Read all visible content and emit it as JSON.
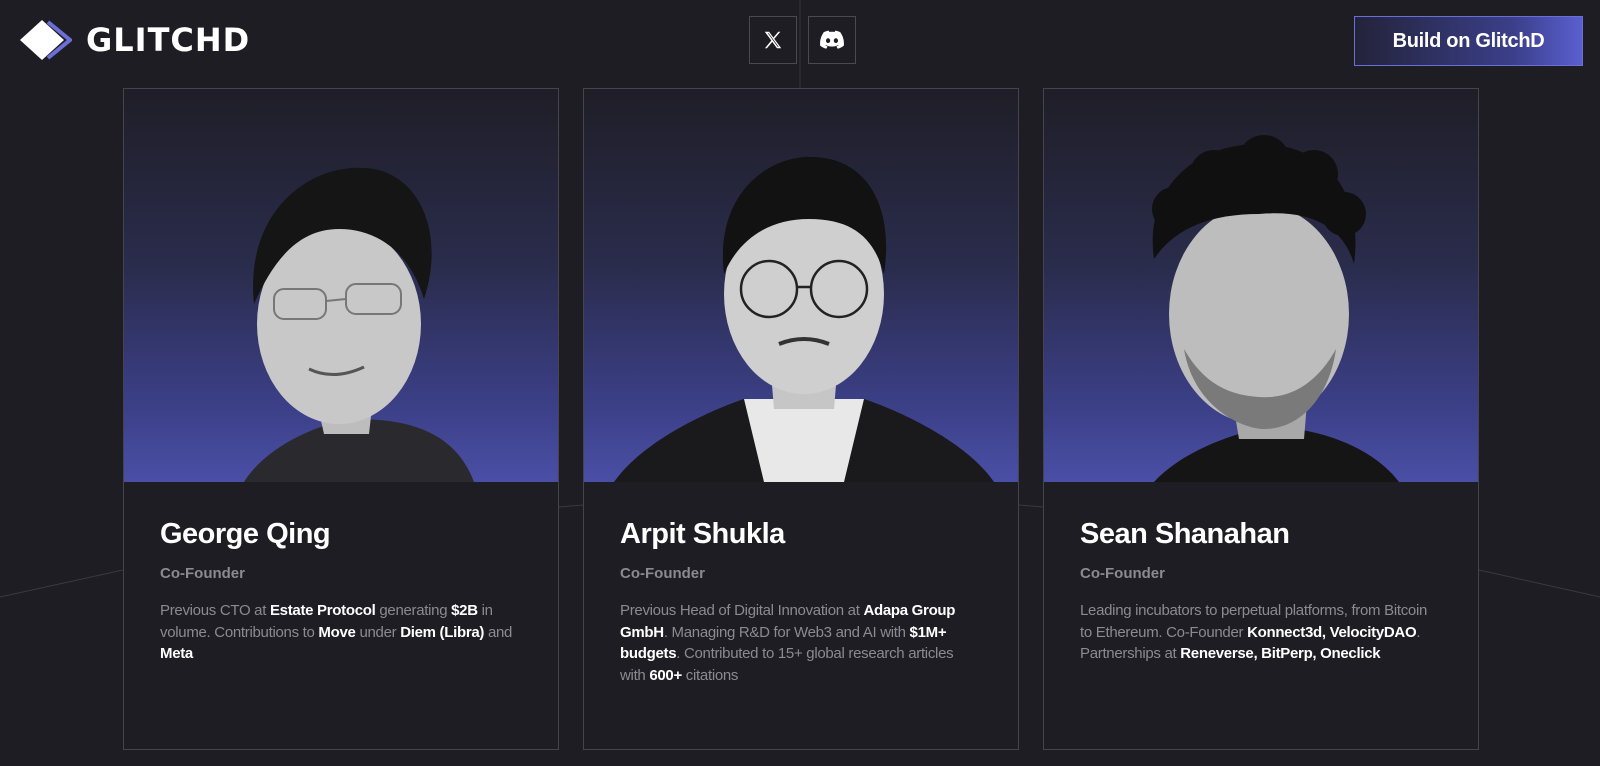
{
  "brand": {
    "name": "GLITCHD"
  },
  "header": {
    "social": [
      {
        "icon": "x-icon",
        "label": "X"
      },
      {
        "icon": "discord-icon",
        "label": "Discord"
      }
    ],
    "cta_label": "Build on GlitchD"
  },
  "colors": {
    "background": "#1e1d23",
    "accent": "#5a5fd0",
    "muted_text": "#8b8a92",
    "border": "#45444c"
  },
  "team": [
    {
      "name": "George Qing",
      "role": "Co-Founder",
      "bio": [
        {
          "t": "Previous CTO at ",
          "b": false
        },
        {
          "t": "Estate Protocol",
          "b": true
        },
        {
          "t": " generating ",
          "b": false
        },
        {
          "t": "$2B",
          "b": true
        },
        {
          "t": " in volume. Contributions to ",
          "b": false
        },
        {
          "t": "Move",
          "b": true
        },
        {
          "t": " under ",
          "b": false
        },
        {
          "t": "Diem (Libra)",
          "b": true
        },
        {
          "t": " and ",
          "b": false
        },
        {
          "t": "Meta",
          "b": true
        }
      ]
    },
    {
      "name": "Arpit Shukla",
      "role": "Co-Founder",
      "bio": [
        {
          "t": "Previous Head of Digital Innovation at ",
          "b": false
        },
        {
          "t": "Adapa Group GmbH",
          "b": true
        },
        {
          "t": ". Managing R&D for Web3 and AI with ",
          "b": false
        },
        {
          "t": "$1M+ budgets",
          "b": true
        },
        {
          "t": ". Contributed to 15+ global research articles with ",
          "b": false
        },
        {
          "t": "600+",
          "b": true
        },
        {
          "t": " citations",
          "b": false
        }
      ]
    },
    {
      "name": "Sean Shanahan",
      "role": "Co-Founder",
      "bio": [
        {
          "t": "Leading incubators to perpetual platforms, from Bitcoin to Ethereum. Co-Founder ",
          "b": false
        },
        {
          "t": "Konnect3d, VelocityDAO",
          "b": true
        },
        {
          "t": ". Partnerships at ",
          "b": false
        },
        {
          "t": "Reneverse, BitPerp, Oneclick",
          "b": true
        }
      ]
    }
  ]
}
